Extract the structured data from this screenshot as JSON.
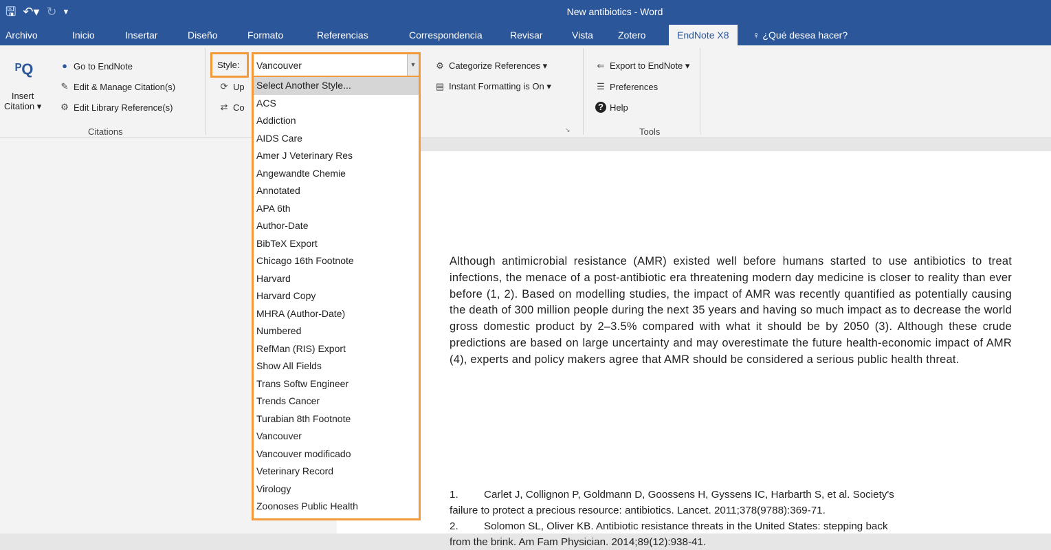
{
  "window": {
    "title": "New antibiotics - Word"
  },
  "tabs": [
    {
      "label": "Archivo"
    },
    {
      "label": "Inicio"
    },
    {
      "label": "Insertar"
    },
    {
      "label": "Diseño"
    },
    {
      "label": "Formato"
    },
    {
      "label": "Referencias"
    },
    {
      "label": "Correspondencia"
    },
    {
      "label": "Revisar"
    },
    {
      "label": "Vista"
    },
    {
      "label": "Zotero"
    },
    {
      "label": "EndNote X8"
    },
    {
      "label": "¿Qué desea hacer?"
    }
  ],
  "ribbon": {
    "citations": {
      "insert_line1": "Insert",
      "insert_line2": "Citation ▾",
      "go_to_endnote": "Go to EndNote",
      "edit_manage": "Edit & Manage Citation(s)",
      "edit_library": "Edit Library Reference(s)",
      "group_label": "Citations"
    },
    "bibliography": {
      "style_label": "Style:",
      "style_value": "Vancouver",
      "update_partial": "Up",
      "convert_partial": "Co"
    },
    "categorize": {
      "categorize_refs": "Categorize References ▾",
      "instant_formatting": "Instant Formatting is On ▾"
    },
    "tools": {
      "export": "Export to EndNote ▾",
      "preferences": "Preferences",
      "help": "Help",
      "group_label": "Tools"
    }
  },
  "style_dropdown": {
    "items": [
      "Select Another Style...",
      "ACS",
      "Addiction",
      "AIDS Care",
      "Amer J Veterinary Res",
      "Angewandte Chemie",
      "Annotated",
      "APA 6th",
      "Author-Date",
      "BibTeX Export",
      "Chicago 16th Footnote",
      "Harvard",
      "Harvard Copy",
      "MHRA (Author-Date)",
      "Numbered",
      "RefMan (RIS) Export",
      "Show All Fields",
      "Trans Softw Engineer",
      "Trends Cancer",
      "Turabian 8th Footnote",
      "Vancouver",
      "Vancouver modificado",
      "Veterinary Record",
      "Virology",
      "Zoonoses Public Health"
    ]
  },
  "document": {
    "paragraph": "Although antimicrobial resistance (AMR) existed well before humans started to use antibiotics to treat infections, the menace of a post-antibiotic era threatening modern day medicine is closer to reality than ever before (1, 2). Based on modelling studies, the impact of AMR was recently quantified as potentially causing the death of 300 million people during the next 35 years and having so much impact as to decrease the world gross domestic product by 2–3.5% compared with what it should be by 2050 (3). Although these crude predictions are based on large uncertainty and may overestimate the future health-economic impact of AMR (4), experts and policy makers agree that AMR should be considered a serious public health threat.",
    "references": [
      {
        "num": "1.",
        "line1": "Carlet J, Collignon P, Goldmann D, Goossens H, Gyssens IC, Harbarth S, et al. Society's",
        "line2": "failure to protect a precious resource: antibiotics. Lancet. 2011;378(9788):369-71."
      },
      {
        "num": "2.",
        "line1": "Solomon SL, Oliver KB. Antibiotic resistance threats in the United States: stepping back",
        "line2": "from the brink. Am Fam Physician. 2014;89(12):938-41."
      }
    ]
  },
  "colors": {
    "titlebar": "#2b579a",
    "highlight": "#f29a3a"
  }
}
